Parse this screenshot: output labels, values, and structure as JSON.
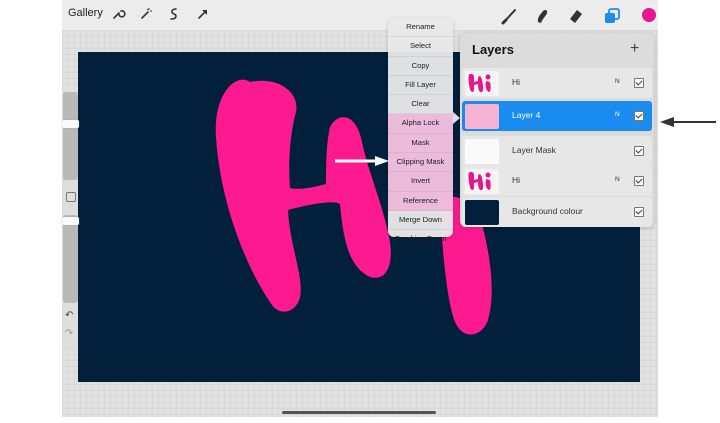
{
  "toolbar": {
    "gallery_label": "Gallery",
    "left_tools": [
      "wrench-icon",
      "magic-wand-icon",
      "selection-icon",
      "transform-arrow-icon"
    ],
    "right_tools": [
      "brush-icon",
      "smudge-icon",
      "eraser-icon",
      "layers-icon"
    ],
    "active_color": "#e8158f"
  },
  "layer_menu": {
    "items": [
      "Rename",
      "Select",
      "Copy",
      "Fill Layer",
      "Clear",
      "Alpha Lock",
      "Mask",
      "Clipping Mask",
      "Invert",
      "Reference",
      "Merge Down",
      "Combine Down"
    ]
  },
  "layers_panel": {
    "title": "Layers",
    "add_icon": "+",
    "layers": [
      {
        "name": "Hi",
        "mode": "N",
        "selected": false,
        "visible": true
      },
      {
        "name": "Layer 4",
        "mode": "N",
        "selected": true,
        "visible": true
      },
      {
        "name": "Layer Mask",
        "mode": "",
        "selected": false,
        "visible": true
      },
      {
        "name": "Hi",
        "mode": "N",
        "selected": false,
        "visible": true
      },
      {
        "name": "Background colour",
        "mode": "",
        "selected": false,
        "visible": true
      }
    ]
  },
  "canvas": {
    "background_color": "#021f3b",
    "stroke_color": "#fd1a90"
  }
}
